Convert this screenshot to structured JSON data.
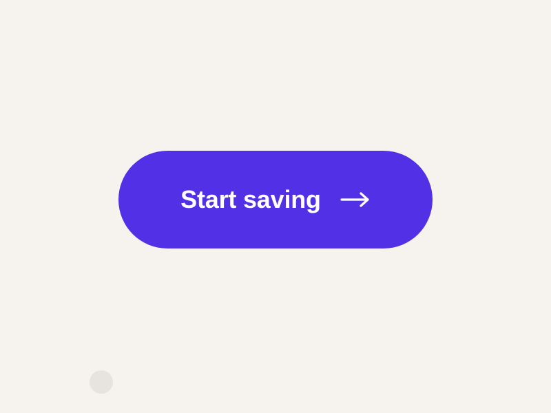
{
  "cta": {
    "label": "Start saving",
    "icon": "arrow-right-icon"
  },
  "colors": {
    "accent": "#5130e6",
    "background": "#f6f2ee",
    "text_on_accent": "#ffffff",
    "dot": "#e7e3df"
  }
}
